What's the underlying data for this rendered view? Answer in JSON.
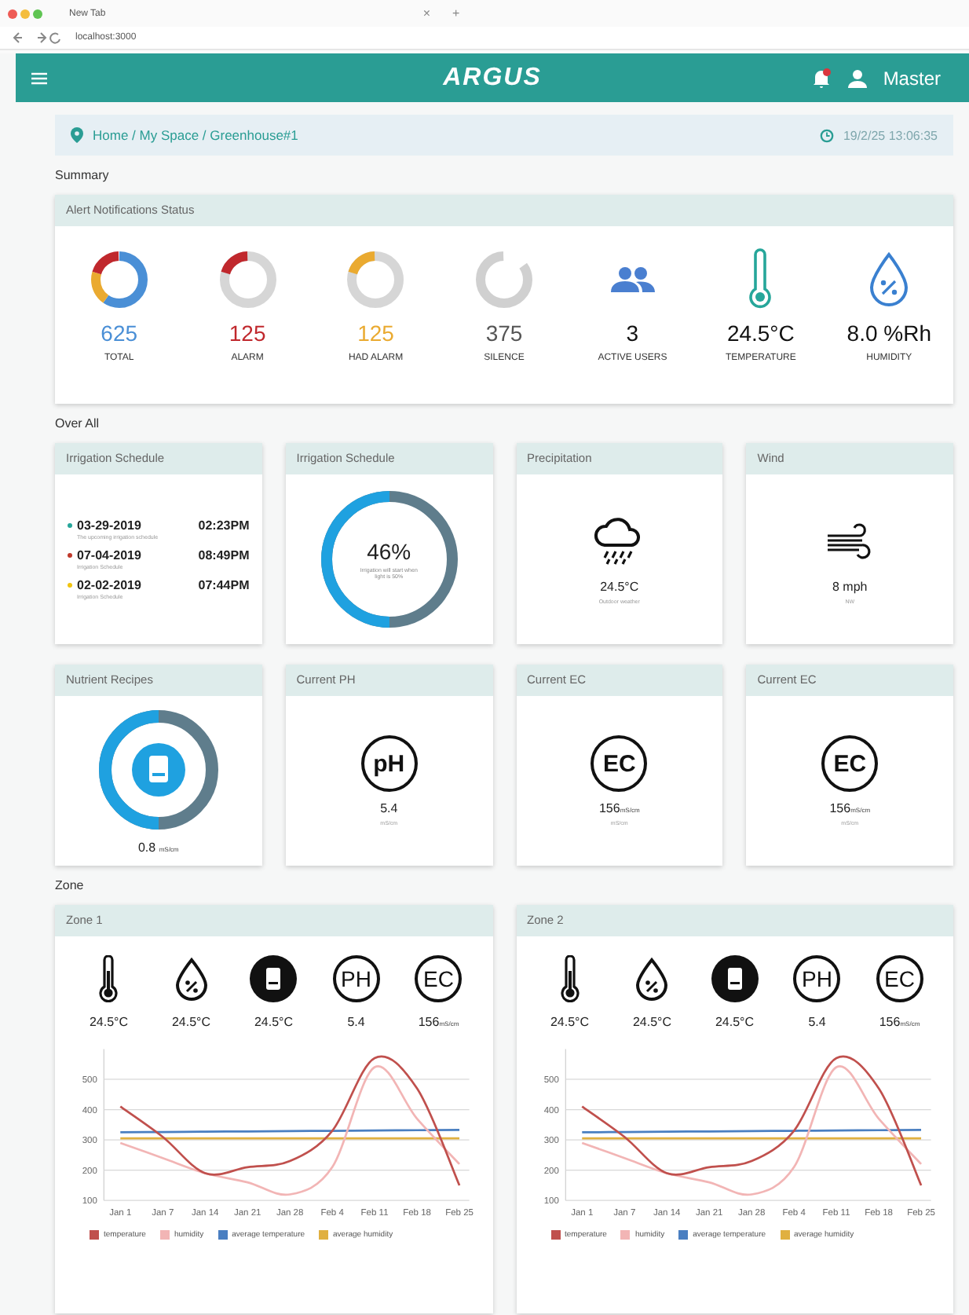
{
  "browser": {
    "tab_title": "New Tab",
    "tab_close": "×",
    "new_tab": "+",
    "address": "localhost:3000"
  },
  "header": {
    "logo": "ARGUS",
    "user": "Master"
  },
  "breadcrumb": {
    "path": "Home / My Space / Greenhouse#1",
    "datetime": "19/2/25 13:06:35"
  },
  "summary": {
    "title": "Summary",
    "card_title": "Alert Notifications Status",
    "stats": [
      {
        "kind": "total_ring",
        "value": "625",
        "label": "TOTAL",
        "color": "#4a8fd6"
      },
      {
        "kind": "ring",
        "value": "125",
        "label": "ALARM",
        "color": "#c0282d"
      },
      {
        "kind": "ring",
        "value": "125",
        "label": "HAD ALARM",
        "color": "#eaaa30"
      },
      {
        "kind": "open_ring",
        "value": "375",
        "label": "SILENCE",
        "color": "#555555"
      },
      {
        "kind": "users",
        "value": "3",
        "label": "ACTIVE USERS"
      },
      {
        "kind": "thermometer",
        "value": "24.5°C",
        "label": "TEMPERATURE"
      },
      {
        "kind": "humidity",
        "value": "8.0 %Rh",
        "label": "HUMIDITY"
      }
    ]
  },
  "overall": {
    "title": "Over All",
    "cards": [
      {
        "kind": "schedule",
        "title": "Irrigation Schedule",
        "items": [
          {
            "date": "03-29-2019",
            "time": "02:23PM",
            "note": "The upcoming irrigation schedule",
            "color": "#26a69a"
          },
          {
            "date": "07-04-2019",
            "time": "08:49PM",
            "note": "Irrigation Schedule",
            "color": "#c0392b"
          },
          {
            "date": "02-02-2019",
            "time": "07:44PM",
            "note": "Irrigation Schedule",
            "color": "#f1c40f"
          }
        ]
      },
      {
        "kind": "progress",
        "title": "Irrigation Schedule",
        "value": "46%",
        "note": "Irrigation will start when light is 50%"
      },
      {
        "kind": "rain",
        "title": "Precipitation",
        "value": "24.5°C",
        "note": "Outdoor weather"
      },
      {
        "kind": "wind",
        "title": "Wind",
        "value": "8 mph",
        "note": "NW"
      },
      {
        "kind": "nutrient",
        "title": "Nutrient Recipes",
        "value": "0.8",
        "unit": "mS/cm"
      },
      {
        "kind": "badge",
        "title": "Current PH",
        "badge": "pH",
        "value": "5.4",
        "note": "mS/cm"
      },
      {
        "kind": "badge",
        "title": "Current EC",
        "badge": "EC",
        "value": "156",
        "unit": "mS/cm",
        "note": "mS/cm"
      },
      {
        "kind": "badge",
        "title": "Current EC",
        "badge": "EC",
        "value": "156",
        "unit": "mS/cm",
        "note": "mS/cm"
      }
    ]
  },
  "zone": {
    "title": "Zone",
    "zones": [
      {
        "title": "Zone 1",
        "sensors": [
          {
            "kind": "thermometer",
            "value": "24.5°C"
          },
          {
            "kind": "humidity",
            "value": "24.5°C"
          },
          {
            "kind": "nutrient",
            "value": "24.5°C"
          },
          {
            "kind": "badge",
            "badge": "PH",
            "value": "5.4"
          },
          {
            "kind": "badge",
            "badge": "EC",
            "value": "156",
            "unit": "mS/cm"
          }
        ],
        "chart_data": {
          "type": "line",
          "grid": true,
          "legend": "bottom",
          "categories": [
            "Jan 1",
            "Jan 7",
            "Jan 14",
            "Jan 21",
            "Jan 28",
            "Feb 4",
            "Feb 11",
            "Feb 18",
            "Feb 25"
          ],
          "ylim": [
            100,
            600
          ],
          "yticks": [
            100,
            200,
            300,
            400,
            500
          ],
          "series": [
            {
              "name": "temperature",
              "color": "#c0504d",
              "values": [
                410,
                310,
                190,
                210,
                230,
                330,
                570,
                470,
                150
              ]
            },
            {
              "name": "humidity",
              "color": "#f2b5b5",
              "values": [
                290,
                240,
                190,
                160,
                120,
                210,
                540,
                370,
                220
              ]
            },
            {
              "name": "average temperature",
              "color": "#4a7fc1",
              "values": [
                325,
                326,
                327,
                328,
                329,
                330,
                331,
                332,
                333
              ]
            },
            {
              "name": "average humidity",
              "color": "#e0b040",
              "values": [
                305,
                305,
                305,
                305,
                305,
                305,
                305,
                305,
                305
              ]
            }
          ]
        }
      },
      {
        "title": "Zone 2",
        "sensors": [
          {
            "kind": "thermometer",
            "value": "24.5°C"
          },
          {
            "kind": "humidity",
            "value": "24.5°C"
          },
          {
            "kind": "nutrient",
            "value": "24.5°C"
          },
          {
            "kind": "badge",
            "badge": "PH",
            "value": "5.4"
          },
          {
            "kind": "badge",
            "badge": "EC",
            "value": "156",
            "unit": "mS/cm"
          }
        ],
        "chart_data": {
          "type": "line",
          "grid": true,
          "legend": "bottom",
          "categories": [
            "Jan 1",
            "Jan 7",
            "Jan 14",
            "Jan 21",
            "Jan 28",
            "Feb 4",
            "Feb 11",
            "Feb 18",
            "Feb 25"
          ],
          "ylim": [
            100,
            600
          ],
          "yticks": [
            100,
            200,
            300,
            400,
            500
          ],
          "series": [
            {
              "name": "temperature",
              "color": "#c0504d",
              "values": [
                410,
                310,
                190,
                210,
                230,
                330,
                570,
                470,
                150
              ]
            },
            {
              "name": "humidity",
              "color": "#f2b5b5",
              "values": [
                290,
                240,
                190,
                160,
                120,
                210,
                540,
                370,
                220
              ]
            },
            {
              "name": "average temperature",
              "color": "#4a7fc1",
              "values": [
                325,
                326,
                327,
                328,
                329,
                330,
                331,
                332,
                333
              ]
            },
            {
              "name": "average humidity",
              "color": "#e0b040",
              "values": [
                305,
                305,
                305,
                305,
                305,
                305,
                305,
                305,
                305
              ]
            }
          ]
        }
      }
    ]
  }
}
